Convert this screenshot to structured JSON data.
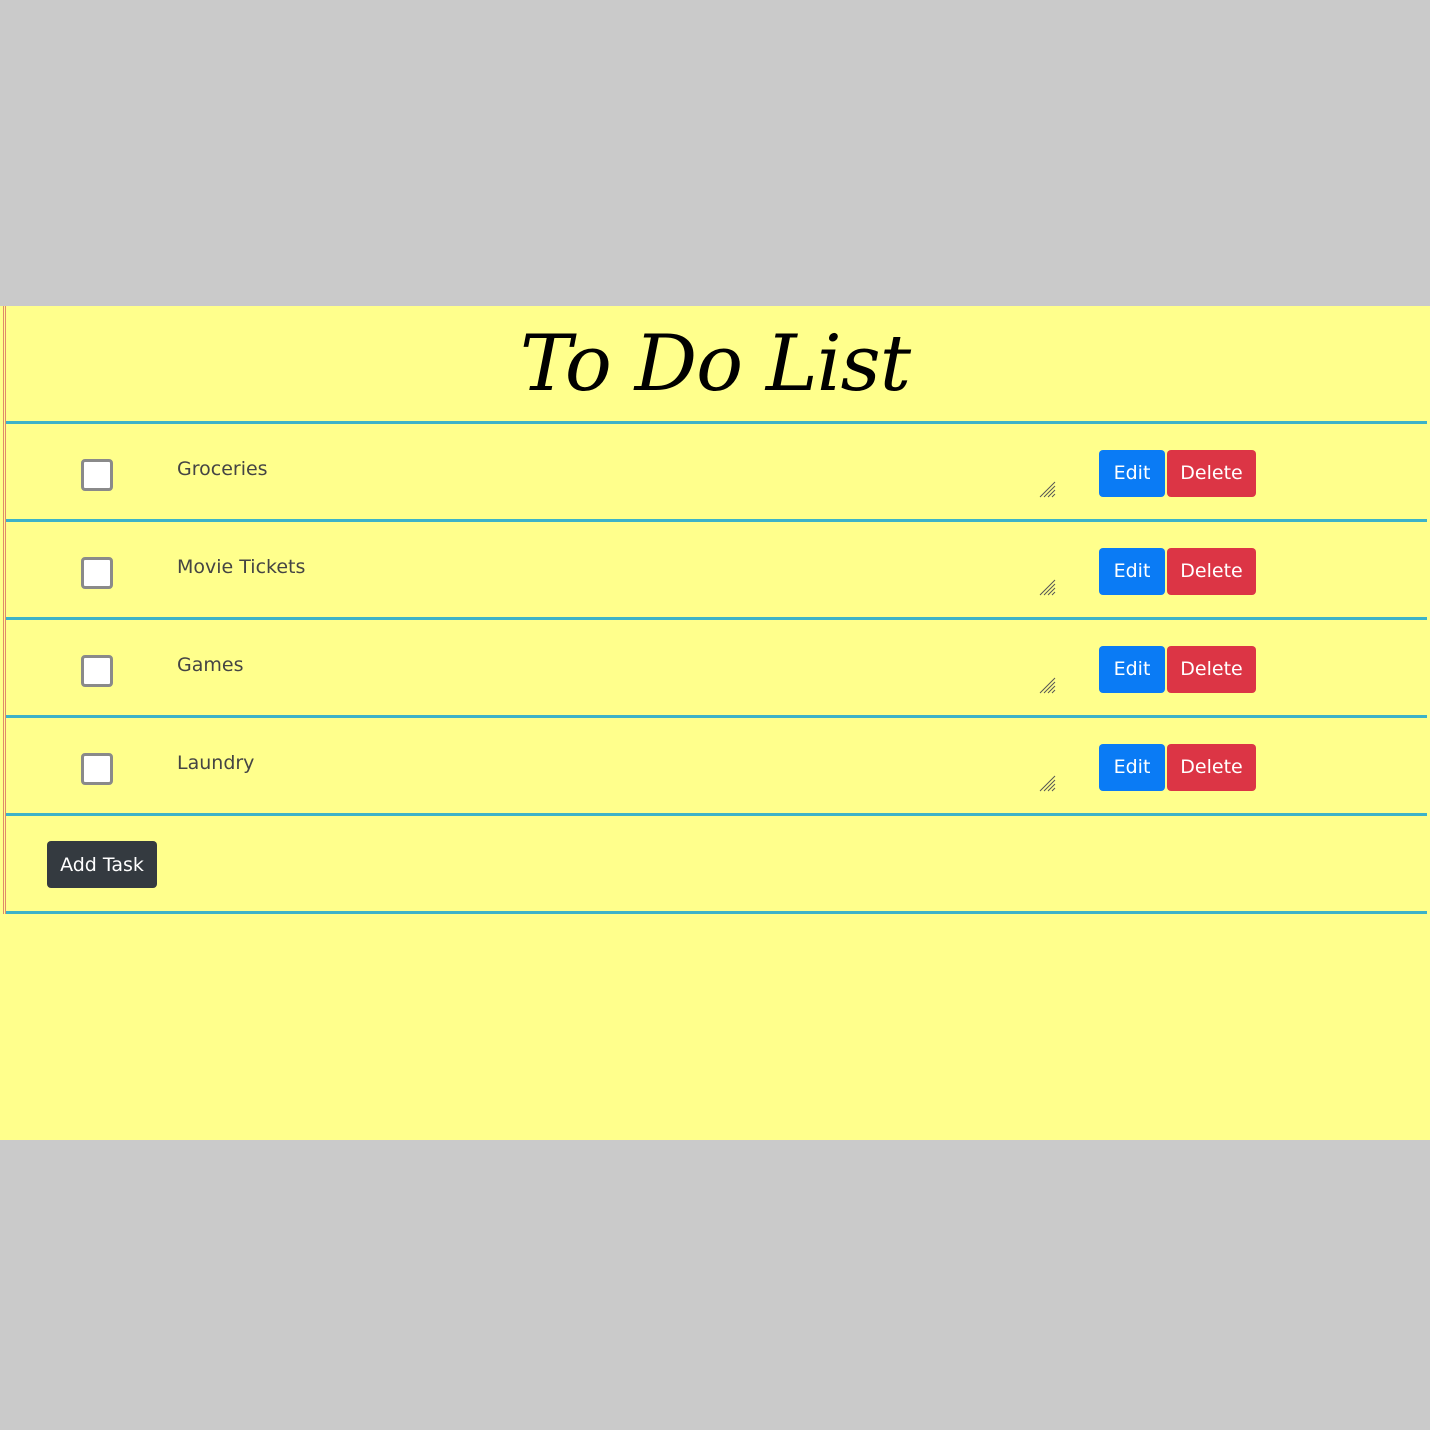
{
  "app": {
    "title": "To Do List"
  },
  "tasks": [
    {
      "label": "Groceries",
      "checked": false
    },
    {
      "label": "Movie Tickets",
      "checked": false
    },
    {
      "label": "Games",
      "checked": false
    },
    {
      "label": "Laundry",
      "checked": false
    }
  ],
  "buttons": {
    "edit_label": "Edit",
    "delete_label": "Delete",
    "add_label": "Add Task"
  },
  "colors": {
    "paper": "#ffff8c",
    "rule": "#3db3c8",
    "edit": "#0a7bf5",
    "delete": "#dc3545",
    "add": "#343a40",
    "background": "#cacaca"
  },
  "icons": {
    "resize": "resize-handle-icon",
    "checkbox": "checkbox-icon"
  }
}
